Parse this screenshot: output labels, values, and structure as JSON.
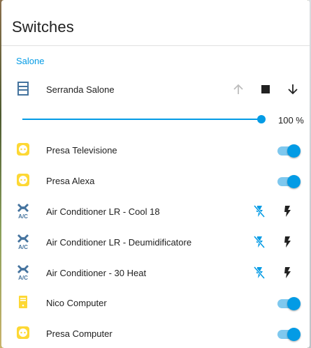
{
  "card": {
    "title": "Switches"
  },
  "section": {
    "label": "Salone"
  },
  "cover": {
    "label": "Serranda Salone",
    "position_percent": 100,
    "position_label": "100 %"
  },
  "entities": [
    {
      "label": "Presa Televisione",
      "icon": "power-socket-icon",
      "state": "on"
    },
    {
      "label": "Presa Alexa",
      "icon": "power-socket-icon",
      "state": "on"
    },
    {
      "label": "Air Conditioner LR - Cool 18",
      "icon": "air-conditioner-icon"
    },
    {
      "label": "Air Conditioner LR - Deumidificatore",
      "icon": "air-conditioner-icon"
    },
    {
      "label": "Air Conditioner - 30 Heat",
      "icon": "air-conditioner-icon"
    },
    {
      "label": "Nico Computer",
      "icon": "desktop-tower-icon",
      "state": "on"
    },
    {
      "label": "Presa Computer",
      "icon": "power-socket-icon",
      "state": "on"
    }
  ],
  "colors": {
    "accent": "#039be5",
    "active_icon": "#fdd835",
    "ac_icon": "#44739e",
    "text": "#212121"
  }
}
